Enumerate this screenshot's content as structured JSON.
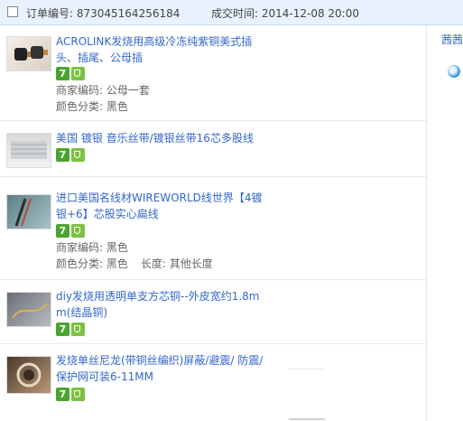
{
  "order": {
    "order_number": "订单编号: 873045164256184",
    "deal_time": "成交时间: 2014-12-08 20:00"
  },
  "items": [
    {
      "title": "ACROLINK发烧用高级冷冻纯紫铜美式插头、插尾、公母插",
      "merchant_code": "商家编码: 公母一套",
      "color": "颜色分类: 黑色",
      "thumb_icon": "plug-thumbnail"
    },
    {
      "title": "美国 镀银 音乐丝带/镀银丝带16芯多股线",
      "thumb_icon": "silver-ribbon-thumbnail"
    },
    {
      "title": "进口美国名线材WIREWORLD线世界【4镀银+6】芯股实心扁线",
      "merchant_code": "商家编码: 黑色",
      "color": "颜色分类: 黑色",
      "length": "长度: 其他长度",
      "thumb_icon": "wire-thumbnail"
    },
    {
      "title": "diy发烧用透明单支方芯铜--外皮宽约1.8mm(结晶铜)",
      "thumb_icon": "copper-wire-thumbnail"
    },
    {
      "title": "发烧单丝尼龙(带铜丝编织)屏蔽/避震/ 防震/ 保护网可装6-11MM",
      "thumb_icon": "nylon-sleeve-thumbnail"
    }
  ],
  "badges": {
    "seven_day": "7",
    "guarantee_icon": "shield-icon"
  },
  "side": {
    "seller_link": "茜茜"
  }
}
